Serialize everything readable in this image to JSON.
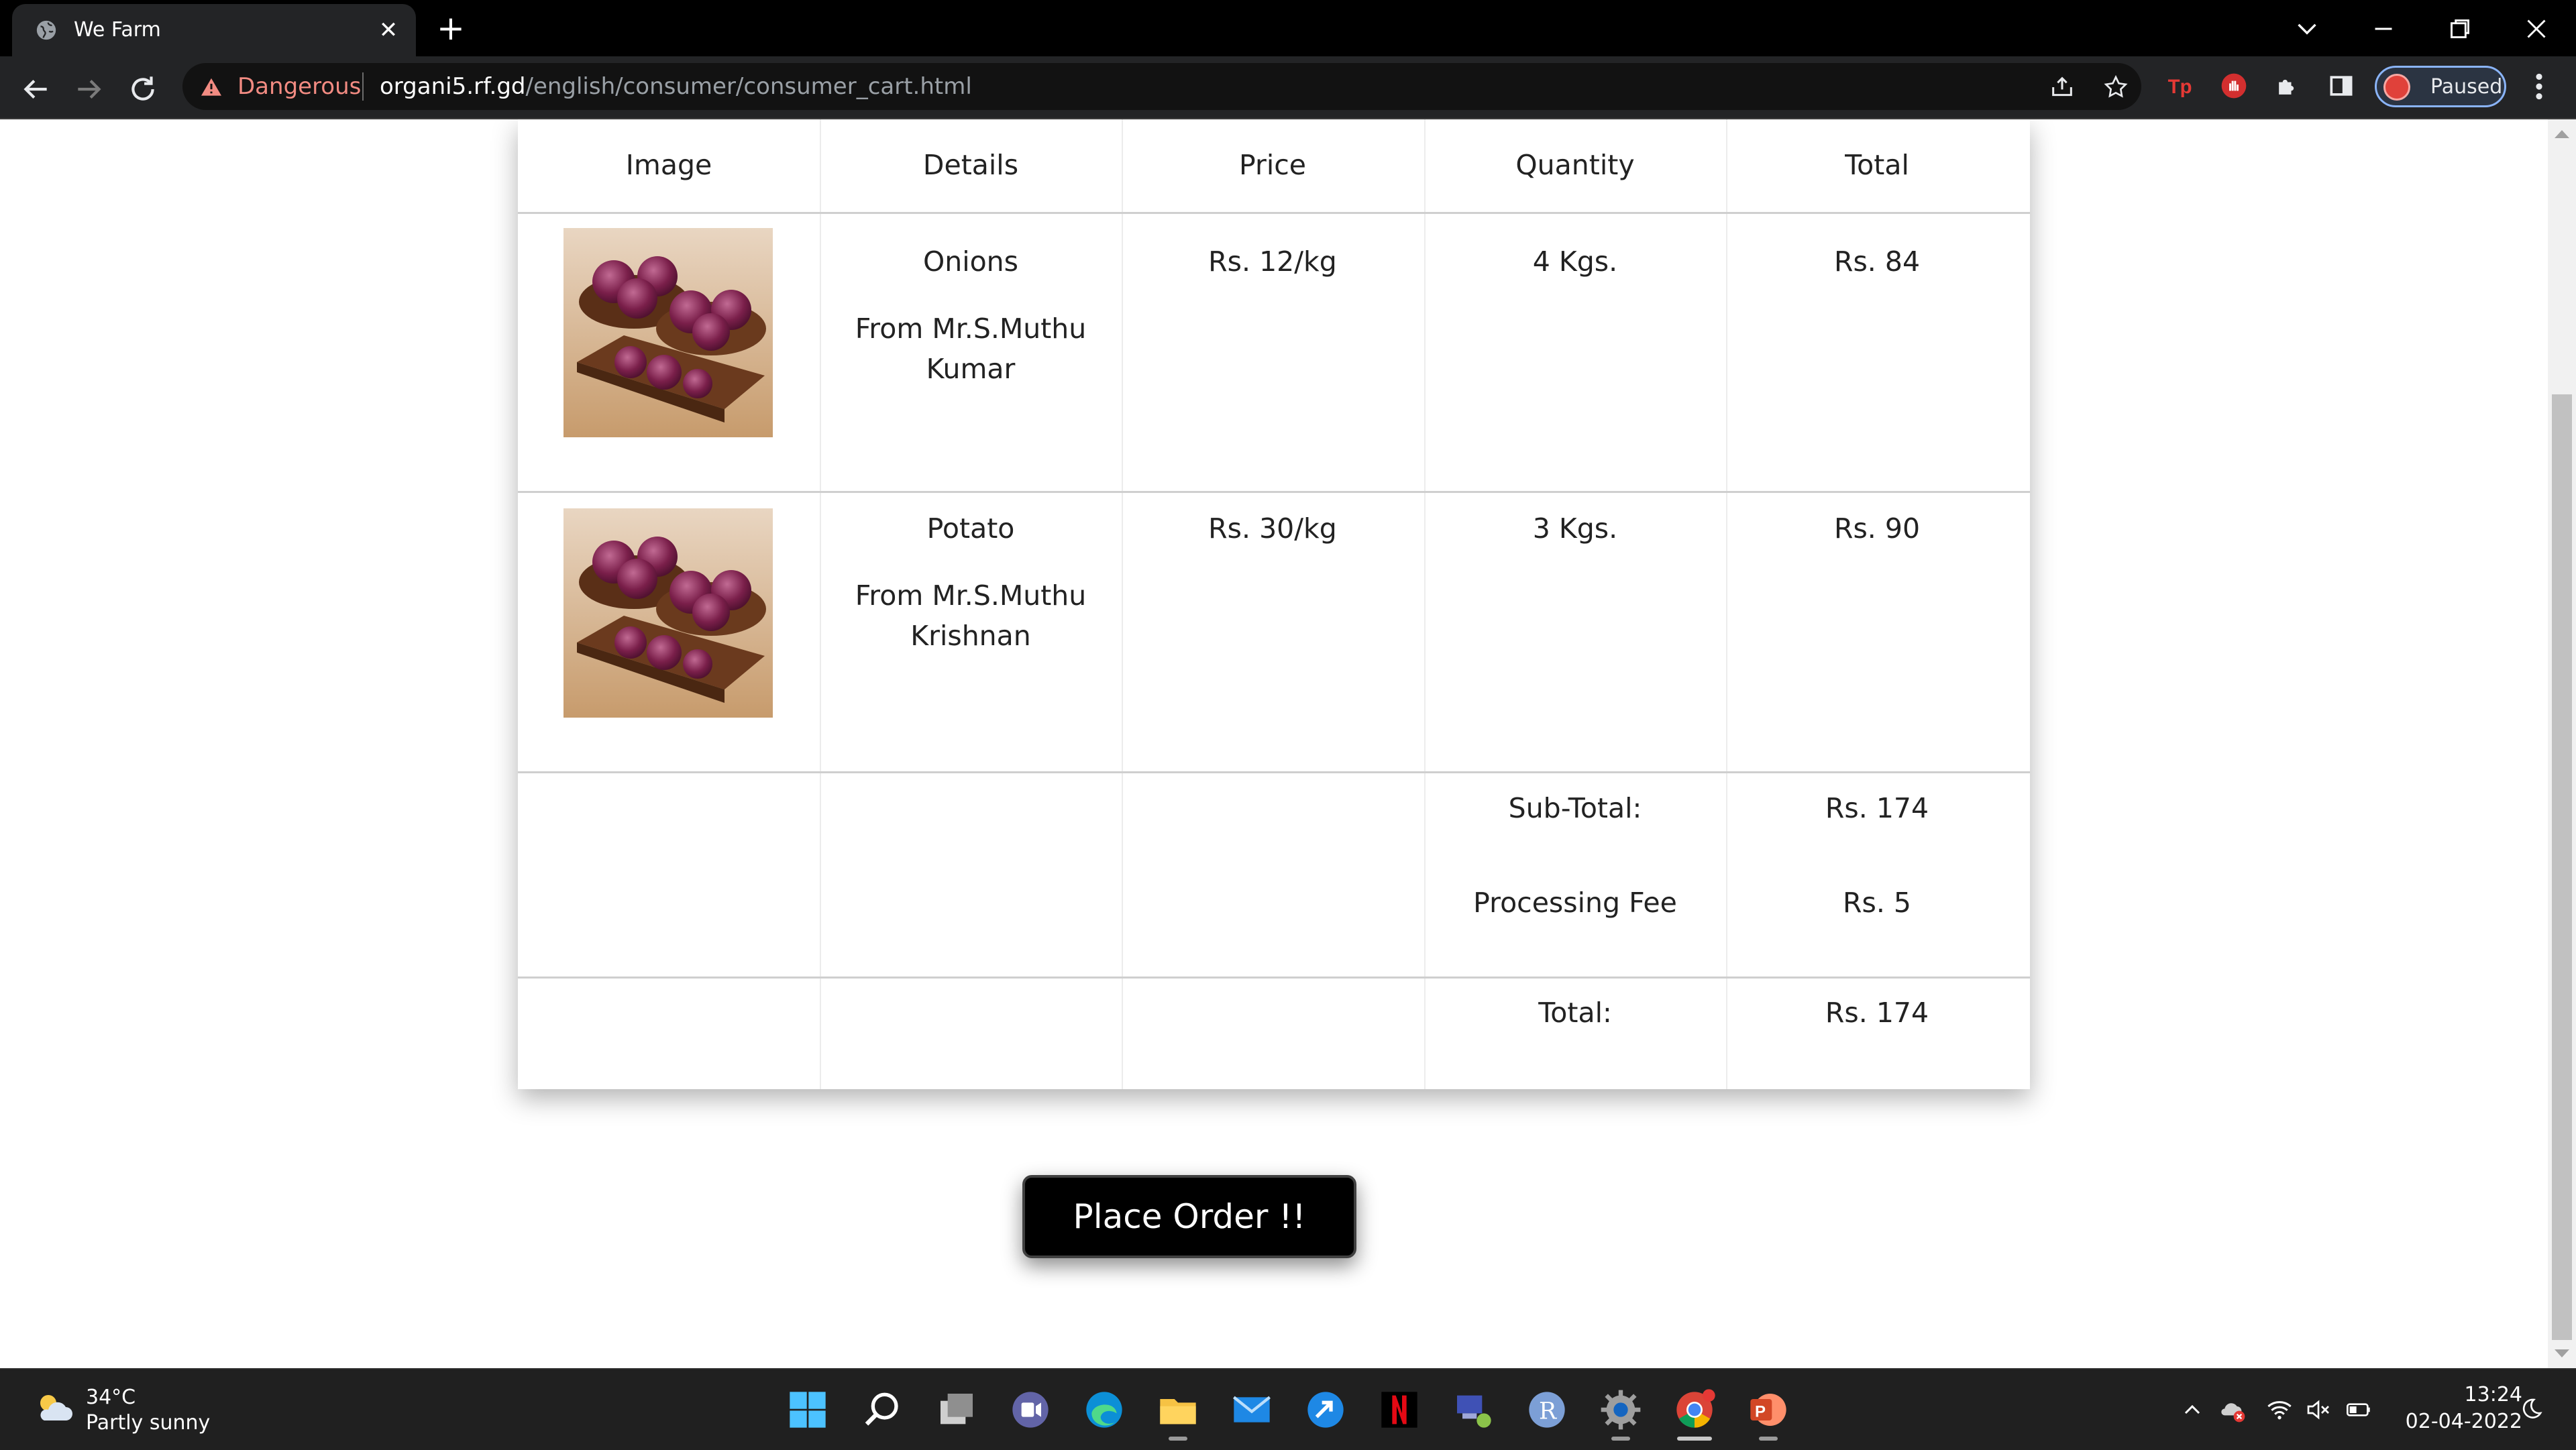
{
  "browser": {
    "tab_title": "We Farm",
    "security_label": "Dangerous",
    "url_host": "organi5.rf.gd",
    "url_path": "/english/consumer/consumer_cart.html",
    "profile_label": "Paused",
    "accent_colors": {
      "danger": "#f28b82",
      "profile_border": "#8ab4f8"
    }
  },
  "cart": {
    "headers": [
      "Image",
      "Details",
      "Price",
      "Quantity",
      "Total"
    ],
    "items": [
      {
        "name": "Onions",
        "seller_line1": "From Mr.S.Muthu",
        "seller_line2": "Kumar",
        "price": "Rs. 12/kg",
        "quantity": "4 Kgs.",
        "total": "Rs. 84"
      },
      {
        "name": "Potato",
        "seller_line1": "From Mr.S.Muthu",
        "seller_line2": "Krishnan",
        "price": "Rs. 30/kg",
        "quantity": "3 Kgs.",
        "total": "Rs. 90"
      }
    ],
    "summary": {
      "subtotal_label": "Sub-Total:",
      "subtotal_value": "Rs. 174",
      "fee_label": "Processing Fee",
      "fee_value": "Rs. 5",
      "total_label": "Total:",
      "total_value": "Rs. 174"
    }
  },
  "place_order_label": "Place Order !!",
  "taskbar": {
    "weather_temp": "34°C",
    "weather_desc": "Partly sunny",
    "apps": [
      "windows-start",
      "search",
      "task-view",
      "teams-chat",
      "edge",
      "file-explorer",
      "mail",
      "app-blue-arrow",
      "netflix",
      "network-tool",
      "r-app",
      "settings",
      "chrome",
      "powerpoint"
    ],
    "clock_time": "13:24",
    "clock_date": "02-04-2022"
  }
}
